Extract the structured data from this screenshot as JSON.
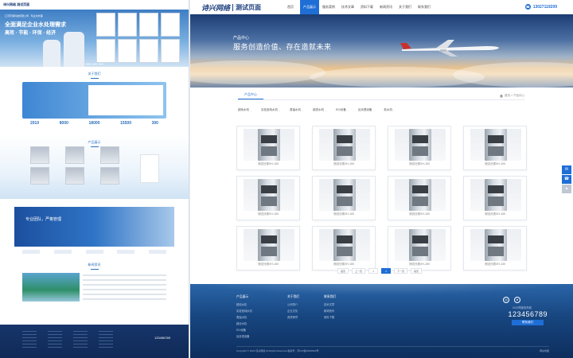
{
  "left_preview": {
    "logo": "诗兴网络 测试页面",
    "hero_tag": "江苏环保科技有限公司 · 专业水处理",
    "hero_title": "全面满足企业水处理需求",
    "hero_subtitle": "高效 · 节能 · 环保 · 经济",
    "about_title": "关于我们",
    "stats": [
      "2010",
      "8000",
      "18000",
      "15500",
      "300"
    ],
    "products_title": "产品展示",
    "banner_text": "专业团队，严格管理",
    "news_title": "新闻资讯",
    "footer_phone": "123456789"
  },
  "nav": {
    "logo_mark": "诗兴网络",
    "logo_sub": "测试页面",
    "items": [
      "首页",
      "产品展示",
      "服务案例",
      "技术文章",
      "资料下载",
      "新闻资讯",
      "关于我们",
      "联系我们"
    ],
    "active_index": 1,
    "phone": "13027119209"
  },
  "hero": {
    "subtitle": "产品中心",
    "title": "服务创造价值、存在造就未来"
  },
  "crumb": {
    "title": "产品中心",
    "path": "首页 > 产品中心"
  },
  "categories": [
    "超纯水机",
    "实验室纯水机",
    "蒸馏水机",
    "超滤水机",
    "EDI设备",
    "反渗透设备",
    "软水机"
  ],
  "products": [
    {
      "label": "测试分类XH-100"
    },
    {
      "label": "测试分类XH-100"
    },
    {
      "label": "测试分类XH-100"
    },
    {
      "label": "测试分类XH-100"
    },
    {
      "label": "测试分类XH-100"
    },
    {
      "label": "测试分类XH-100"
    },
    {
      "label": "测试分类XH-100"
    },
    {
      "label": "测试分类XH-100"
    },
    {
      "label": "测试分类XH-100"
    },
    {
      "label": "测试分类XH-100"
    },
    {
      "label": "测试分类XH-100"
    },
    {
      "label": "测试分类XH-100"
    }
  ],
  "pager": [
    "首页",
    "上一页",
    "1",
    "2",
    "下一页",
    "尾页"
  ],
  "pager_current": 2,
  "footer": {
    "columns": [
      {
        "title": "产品展示",
        "items": [
          "超纯水机",
          "实验室纯水机",
          "蒸馏水机",
          "超滤水机",
          "EDI设备",
          "反渗透设备"
        ]
      },
      {
        "title": "关于我们",
        "items": [
          "公司简介",
          "企业文化",
          "资质荣誉"
        ]
      },
      {
        "title": "联系我们",
        "items": [
          "技术文章",
          "新闻资讯",
          "资料下载"
        ]
      }
    ],
    "hotline_label": "24小时服务热线",
    "hotline": "123456789",
    "contact_btn": "联系我们",
    "copyright": "Copyright © 2020 诗兴网络 All Rights Reserved 备案号：苏ICP备00000000号",
    "copy_right": "网站地图"
  },
  "colors": {
    "accent": "#1f6ed6",
    "brand": "#1d3f7d",
    "footer": "#17457f"
  }
}
